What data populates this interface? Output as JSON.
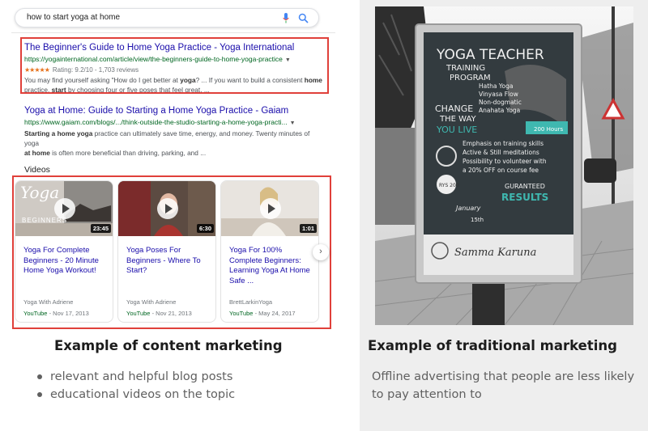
{
  "search": {
    "query": "how to start yoga at home"
  },
  "results": [
    {
      "title": "The Beginner's Guide to Home Yoga Practice - Yoga International",
      "url": "https://yogainternational.com/article/view/the-beginners-guide-to-home-yoga-practice",
      "stars": "★★★★★",
      "rating": "Rating: 9.2/10 - 1,703 reviews",
      "snippet_line1_pre": "You may find yourself asking \"How do I get better at ",
      "snippet_line1_bold": "yoga",
      "snippet_line1_post": "? ... If you want to build a consistent ",
      "snippet_line1_bold2": "home",
      "snippet_line2_pre": "practice, ",
      "snippet_line2_bold": "start",
      "snippet_line2_post": " by choosing four or five poses that feel great, ..."
    },
    {
      "title": "Yoga at Home: Guide to Starting a Home Yoga Practice - Gaiam",
      "url": "https://www.gaiam.com/blogs/.../think-outside-the-studio-starting-a-home-yoga-practi...",
      "snippet_line1_bold": "Starting a home yoga",
      "snippet_line1_post": " practice can ultimately save time, energy, and money. Twenty minutes of yoga",
      "snippet_line2_bold": "at home",
      "snippet_line2_post": " is often more beneficial than driving, parking, and ..."
    }
  ],
  "videos": {
    "heading": "Videos",
    "items": [
      {
        "title": "Yoga For Complete Beginners - 20 Minute Home Yoga Workout!",
        "duration": "23:45",
        "channel": "Yoga With Adriene",
        "source": "YouTube",
        "date": " - Nov 17, 2013",
        "thumb_text_1": "Yoga",
        "thumb_text_2": "BEGINNERS"
      },
      {
        "title": "Yoga Poses For Beginners - Where To Start?",
        "duration": "6:30",
        "channel": "Yoga With Adriene",
        "source": "YouTube",
        "date": " - Nov 21, 2013"
      },
      {
        "title": "Yoga For 100% Complete Beginners: Learning Yoga At Home Safe ...",
        "duration": "1:01",
        "channel": "BrettLarkinYoga",
        "source": "YouTube",
        "date": " - May 24, 2017"
      }
    ],
    "next_glyph": "›"
  },
  "left_caption": "Example of content marketing",
  "left_bullets": [
    "relevant and helpful blog posts",
    "educational videos on the topic"
  ],
  "right_caption": "Example of traditional marketing",
  "right_description": "Offline advertising that people are less likely to pay attention to",
  "poster": {
    "line1": "YOGA TEACHER",
    "line2": "TRAINING",
    "line3": "PROGRAM",
    "styles": [
      "Hatha Yoga",
      "Vinyasa Flow",
      "Non-dogmatic",
      "Anahata Yoga"
    ],
    "change": "CHANGE",
    "the_way": "THE WAY",
    "you_live": "YOU LIVE",
    "hours": "200 Hours",
    "points": [
      "Emphasis on training skills",
      "Active & Still meditations",
      "Possibility to volunteer with",
      "a 20% OFF on course fee"
    ],
    "guaranteed": "GURANTEED",
    "results": "RESULTS",
    "month": "January",
    "day": "15th",
    "ryt": "RYS 200",
    "brand": "Samma Karuna"
  },
  "colors": {
    "highlight": "#e0403a",
    "link": "#1a0dab",
    "url": "#006621",
    "poster_accent": "#3fb8b0"
  }
}
